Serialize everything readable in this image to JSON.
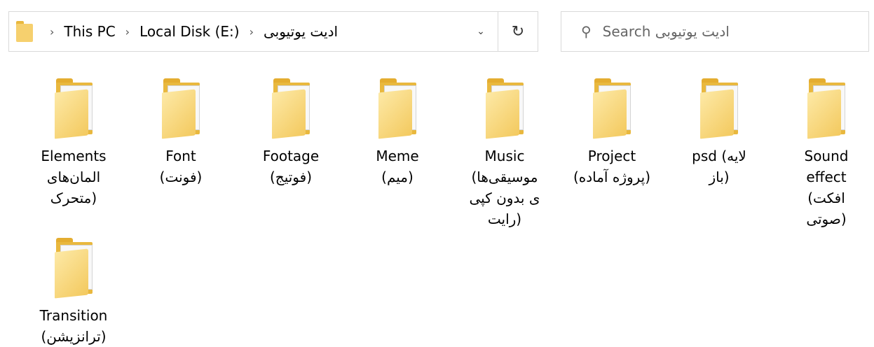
{
  "address_bar": {
    "chevron": "›",
    "crumbs": [
      "This PC",
      "Local Disk (E:)",
      "ادیت یوتیوبی"
    ],
    "dropdown_icon": "chevron-down-icon",
    "refresh_icon": "refresh-icon"
  },
  "search": {
    "placeholder": "Search ادیت یوتیوبی",
    "icon": "search-icon"
  },
  "folders": [
    {
      "lines": [
        "Elements",
        "المان‌های",
        "(متحرک"
      ]
    },
    {
      "lines": [
        "Font",
        "(فونت)"
      ]
    },
    {
      "lines": [
        "Footage",
        "(فوتیج)"
      ]
    },
    {
      "lines": [
        "Meme",
        "(میم)"
      ]
    },
    {
      "lines": [
        "Music",
        "موسیقی‌ها)",
        "ی بدون کپی",
        "(رایت"
      ]
    },
    {
      "lines": [
        "Project",
        "(پروژه آماده)"
      ]
    },
    {
      "lines": [
        "psd (لایه",
        "(باز"
      ]
    },
    {
      "lines": [
        "Sound",
        "effect",
        "افکت)",
        "(صوتی"
      ]
    },
    {
      "lines": [
        "Transition",
        "(ترانزیشن)"
      ]
    }
  ],
  "colors": {
    "folder": "#f3c95e",
    "folder_dark": "#e9b83e",
    "border": "#d9d9d9"
  }
}
